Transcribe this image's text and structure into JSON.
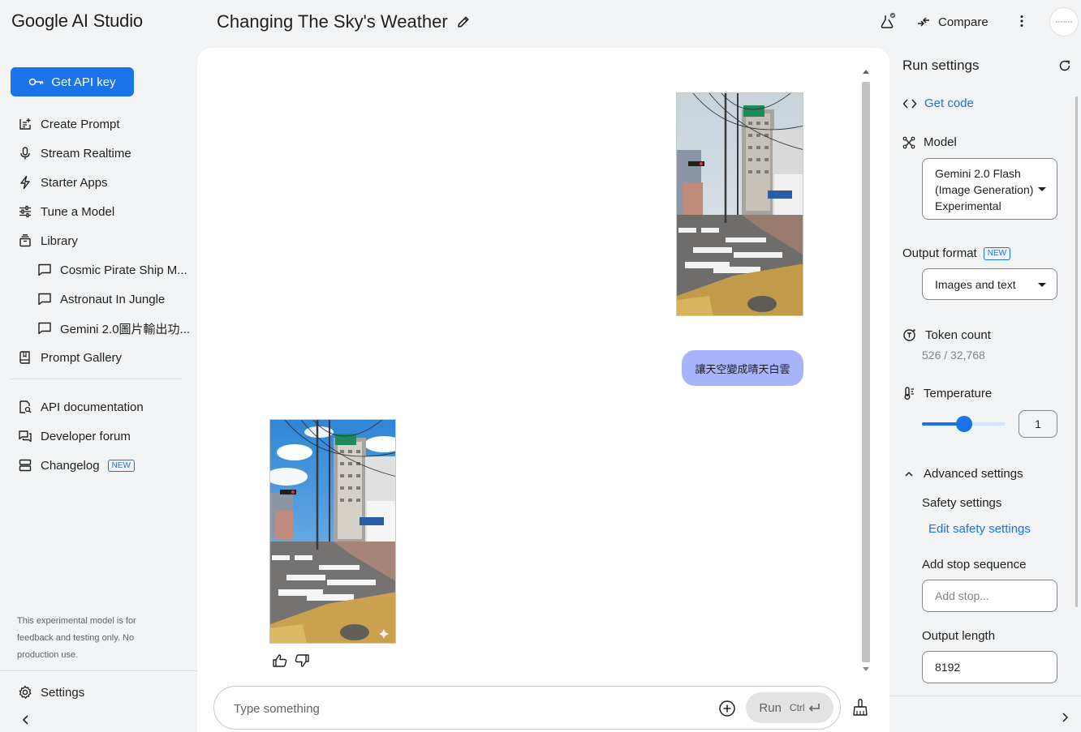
{
  "app": {
    "logo": "Google AI Studio",
    "prompt_title": "Changing The Sky's Weather",
    "compare_label": "Compare"
  },
  "sidebar": {
    "api_key_label": "Get API key",
    "items": [
      {
        "label": "Create Prompt",
        "icon": "create-prompt-icon"
      },
      {
        "label": "Stream Realtime",
        "icon": "microphone-icon"
      },
      {
        "label": "Starter Apps",
        "icon": "bolt-icon"
      },
      {
        "label": "Tune a Model",
        "icon": "tune-icon"
      },
      {
        "label": "Library",
        "icon": "library-icon"
      }
    ],
    "library_items": [
      {
        "label": "Cosmic Pirate Ship M..."
      },
      {
        "label": "Astronaut In Jungle"
      },
      {
        "label": "Gemini 2.0圖片輸出功..."
      }
    ],
    "gallery_label": "Prompt Gallery",
    "links": [
      {
        "label": "API documentation"
      },
      {
        "label": "Developer forum"
      },
      {
        "label": "Changelog",
        "badge": "NEW"
      }
    ],
    "disclaimer": "This experimental model is for feedback and testing only. No production use.",
    "settings_label": "Settings"
  },
  "chat": {
    "user_message": "讓天空變成晴天白雲",
    "input_placeholder": "Type something",
    "run_label": "Run",
    "run_shortcut": "Ctrl"
  },
  "run_settings": {
    "title": "Run settings",
    "get_code": "Get code",
    "model_label": "Model",
    "model_value": [
      "Gemini 2.0 Flash",
      "(Image Generation)",
      "Experimental"
    ],
    "output_format_label": "Output format",
    "output_format_badge": "NEW",
    "output_format_value": "Images and text",
    "token_count_label": "Token count",
    "token_count_value": "526 / 32,768",
    "temperature_label": "Temperature",
    "temperature_value": "1",
    "temperature_fraction": 0.5,
    "advanced_label": "Advanced settings",
    "safety_label": "Safety settings",
    "safety_link": "Edit safety settings",
    "stop_label": "Add stop sequence",
    "stop_placeholder": "Add stop...",
    "output_length_label": "Output length",
    "output_length_value": "8192"
  },
  "colors": {
    "accent": "#1a73e8",
    "user_bubble": "#a8b4fa",
    "background": "#f1f3f4"
  }
}
